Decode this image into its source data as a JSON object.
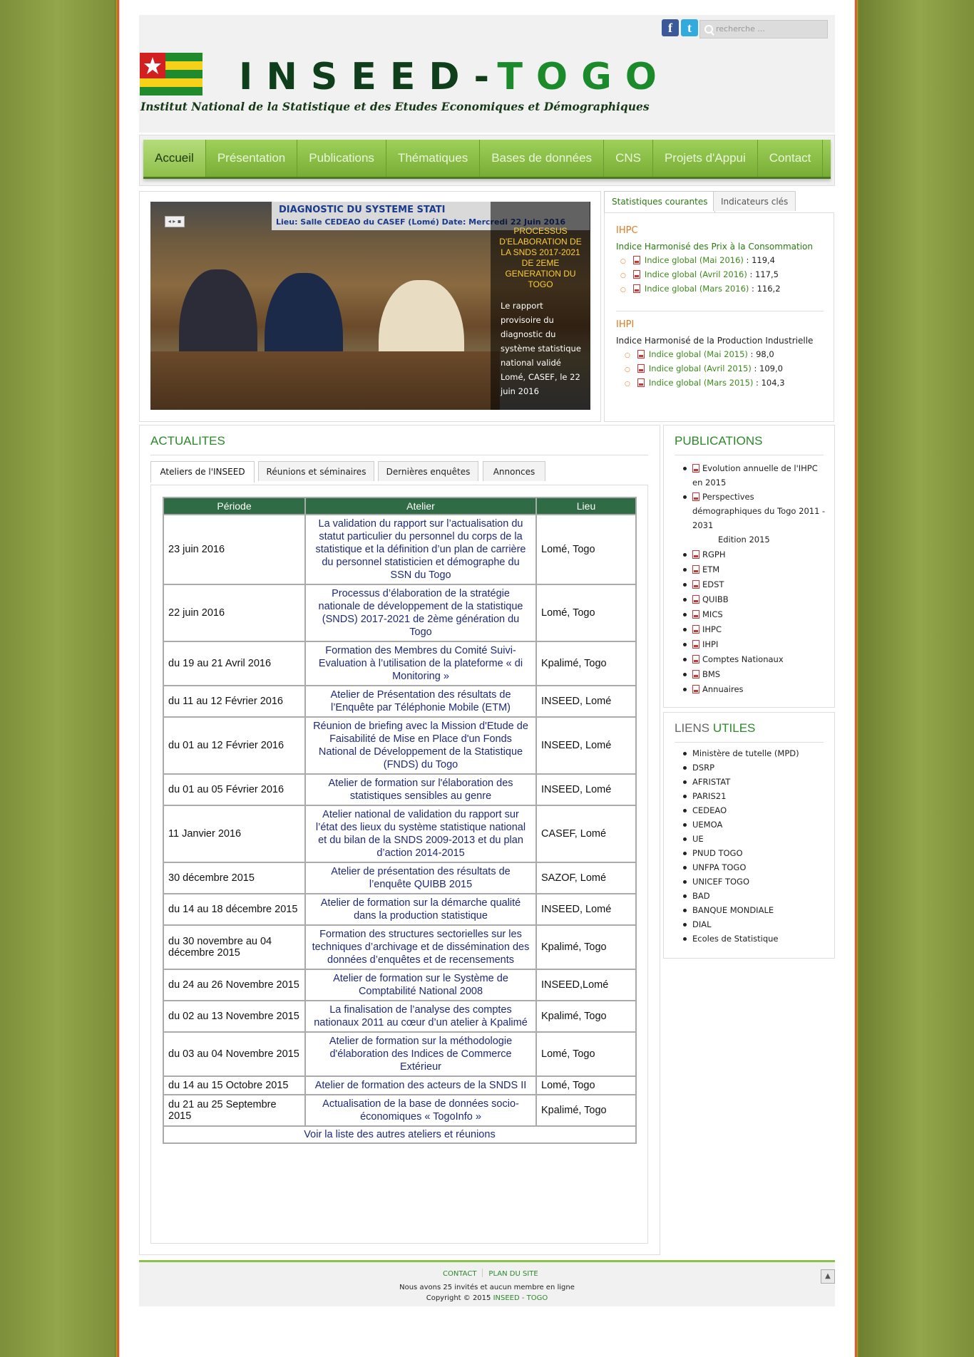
{
  "header": {
    "brand_part1": "INSEED-",
    "brand_part2": "TOGO",
    "subtitle": "Institut National de la Statistique et des Etudes Economiques et Démographiques",
    "search_placeholder": "recherche ...",
    "social": {
      "facebook": "f",
      "twitter": "t"
    }
  },
  "nav": {
    "items": [
      "Accueil",
      "Présentation",
      "Publications",
      "Thématiques",
      "Bases de données",
      "CNS",
      "Projets d'Appui",
      "Contact"
    ],
    "active": "Accueil"
  },
  "slider": {
    "banner_title": "DIAGNOSTIC DU SYSTEME STATI",
    "banner_sub": "Lieu: Salle CEDEAO du CASEF (Lomé)      Date: Mercredi 22 Juin 2016",
    "caption_title": "PROCESSUS D'ELABORATION DE LA SNDS 2017-2021 DE 2EME GENERATION DU TOGO",
    "caption_text": "Le rapport provisoire du diagnostic du système statistique national validé Lomé, CASEF, le 22 juin 2016",
    "control": "◂ ▸ ▪"
  },
  "stats": {
    "tabs": [
      "Statistiques courantes",
      "Indicateurs clés"
    ],
    "ihpc": {
      "code": "IHPC",
      "name": "Indice Harmonisé des Prix à la Consommation",
      "items": [
        {
          "label": "Indice global (Mai 2016)",
          "value": " : 119,4"
        },
        {
          "label": "Indice global (Avril 2016)",
          "value": " : 117,5"
        },
        {
          "label": "Indice global (Mars 2016)",
          "value": " : 116,2"
        }
      ]
    },
    "ihpi": {
      "code": "IHPI",
      "name": "Indice Harmonisé de la Production Industrielle",
      "items": [
        {
          "label": "Indice global (Mai 2015)",
          "value": " : 98,0"
        },
        {
          "label": "Indice global (Avril 2015)",
          "value": " : 109,0"
        },
        {
          "label": "Indice global (Mars 2015)",
          "value": " : 104,3"
        }
      ]
    }
  },
  "actualites": {
    "title": "ACTUALITES",
    "tabs": [
      "Ateliers de l'INSEED",
      "Réunions et séminaires",
      "Dernières enquêtes",
      "Annonces"
    ],
    "columns": [
      "Période",
      "Atelier",
      "Lieu"
    ],
    "rows": [
      {
        "periode": "23 juin 2016",
        "atelier": "La validation du rapport sur l’actualisation du statut particulier du personnel du corps de la statistique et la définition d’un plan de carrière du personnel statisticien et démographe du SSN du Togo",
        "lieu": "Lomé, Togo"
      },
      {
        "periode": "22 juin 2016",
        "atelier": "Processus d’élaboration de la stratégie nationale de développement de la statistique (SNDS) 2017-2021 de 2ème génération du Togo",
        "lieu": "Lomé, Togo"
      },
      {
        "periode": "du 19 au 21 Avril 2016",
        "atelier": "Formation des Membres du Comité Suivi-Evaluation à l’utilisation de la plateforme « di Monitoring »",
        "lieu": "Kpalimé, Togo"
      },
      {
        "periode": "du 11 au 12 Février 2016",
        "atelier": "Atelier de Présentation des résultats de l’Enquête par Téléphonie Mobile (ETM)",
        "lieu": "INSEED, Lomé"
      },
      {
        "periode": "du 01 au 12 Février 2016",
        "atelier": "Réunion de briefing avec la Mission d'Etude de Faisabilité de Mise en Place d'un Fonds National de Développement de la Statistique (FNDS) du Togo",
        "lieu": "INSEED, Lomé"
      },
      {
        "periode": "du 01 au 05 Février 2016",
        "atelier": "Atelier de formation sur l'élaboration des statistiques sensibles au genre",
        "lieu": "INSEED, Lomé"
      },
      {
        "periode": "11 Janvier 2016",
        "atelier": "Atelier national de validation du rapport sur l’état des lieux du système statistique national et du bilan de la SNDS 2009-2013 et du plan d’action 2014-2015",
        "lieu": "CASEF, Lomé"
      },
      {
        "periode": "30 décembre 2015",
        "atelier": "Atelier de présentation des résultats de l’enquête QUIBB 2015",
        "lieu": "SAZOF, Lomé"
      },
      {
        "periode": "du 14 au 18 décembre 2015",
        "atelier": "Atelier de formation sur la démarche qualité dans la production statistique",
        "lieu": "INSEED, Lomé"
      },
      {
        "periode": "du 30 novembre au 04 décembre 2015",
        "atelier": "Formation des structures sectorielles sur les techniques d’archivage et de dissémination des données d’enquêtes et de recensements",
        "lieu": "Kpalimé, Togo"
      },
      {
        "periode": "du 24 au 26 Novembre 2015",
        "atelier": "Atelier de formation sur le Système de Comptabilité National 2008",
        "lieu": "INSEED,Lomé"
      },
      {
        "periode": "du 02 au 13 Novembre 2015",
        "atelier": "La finalisation de l’analyse des comptes nationaux 2011 au cœur d’un atelier à Kpalimé",
        "lieu": "Kpalimé, Togo"
      },
      {
        "periode": "du 03 au 04 Novembre 2015",
        "atelier": "Atelier de formation sur la méthodologie d'élaboration des Indices de Commerce Extérieur",
        "lieu": "Lomé, Togo"
      },
      {
        "periode": "du 14 au 15 Octobre 2015",
        "atelier": "Atelier de formation des acteurs de la SNDS II",
        "lieu": "Lomé, Togo"
      },
      {
        "periode": "du 21 au 25 Septembre 2015",
        "atelier": "Actualisation de la base de données socio-économiques « TogoInfo »",
        "lieu": "Kpalimé, Togo"
      }
    ],
    "more_link": "Voir la liste des autres ateliers et réunions"
  },
  "publications": {
    "title": "PUBLICATIONS",
    "items": [
      {
        "lines": [
          "Evolution annuelle de l'IHPC",
          "en 2015"
        ]
      },
      {
        "lines": [
          "Perspectives",
          "démographiques du Togo 2011 -",
          "2031"
        ]
      },
      {
        "lines": [
          "RGPH"
        ]
      },
      {
        "lines": [
          "ETM"
        ]
      },
      {
        "lines": [
          "EDST"
        ]
      },
      {
        "lines": [
          "QUIBB"
        ]
      },
      {
        "lines": [
          "MICS"
        ]
      },
      {
        "lines": [
          "IHPC"
        ]
      },
      {
        "lines": [
          "IHPI"
        ]
      },
      {
        "lines": [
          "Comptes Nationaux"
        ]
      },
      {
        "lines": [
          "BMS"
        ]
      },
      {
        "lines": [
          "Annuaires"
        ]
      }
    ],
    "edition_note": "Edition 2015"
  },
  "liens": {
    "title_part1": "LIENS ",
    "title_part2": "UTILES",
    "items": [
      "Ministère de tutelle (MPD)",
      "DSRP",
      "AFRISTAT",
      "PARIS21",
      "CEDEAO",
      "UEMOA",
      "UE",
      "PNUD TOGO",
      "UNFPA TOGO",
      "UNICEF TOGO",
      "BAD",
      "BANQUE MONDIALE",
      "DIAL",
      "Ecoles de Statistique"
    ]
  },
  "footer": {
    "links": [
      "CONTACT",
      "PLAN DU SITE"
    ],
    "online": "Nous avons 25 invités et aucun membre en ligne",
    "copyright": "Copyright © 2015 ",
    "copyright_name": "INSEED - TOGO",
    "totop": "▲"
  },
  "colors": {
    "accent": "#2a8a2a",
    "nav": "#8cc04a",
    "orange": "#e07a20",
    "table_header": "#2f6b44"
  }
}
